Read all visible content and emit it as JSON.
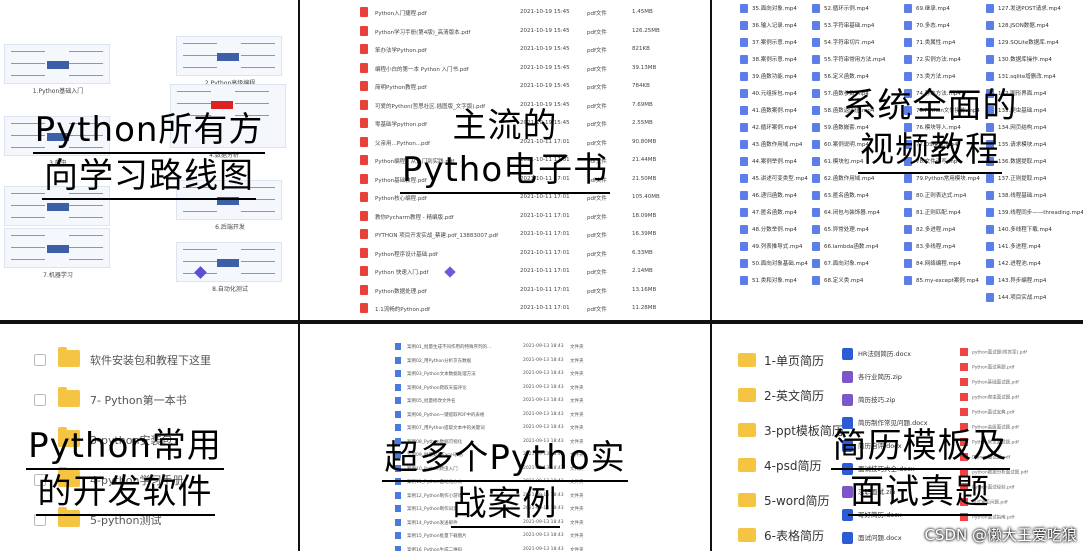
{
  "panels": {
    "roadmap": {
      "title_line1": "Python所有方",
      "title_line2": "向学习路线图",
      "maps": [
        {
          "caption": "1.Python基础入门"
        },
        {
          "caption": "2.Python高级编程"
        },
        {
          "caption": "3.爬虫"
        },
        {
          "caption": "4.数据分析"
        },
        {
          "caption": "5.前端开发"
        },
        {
          "caption": "6.后端开发"
        },
        {
          "caption": "7.机器学习"
        },
        {
          "caption": "8.自动化测试"
        }
      ]
    },
    "ebooks": {
      "title_line1": "主流的",
      "title_line2": "Pytho电子书",
      "rows": [
        {
          "name": "Python入门捷程.pdf",
          "date": "2021-10-19 15:45",
          "type": "pdf文件",
          "size": "1.45MB"
        },
        {
          "name": "Python学习手册(第4版)_高清版本.pdf",
          "date": "2021-10-19 15:45",
          "type": "pdf文件",
          "size": "126.25MB"
        },
        {
          "name": "笨办法学Python.pdf",
          "date": "2021-10-19 15:45",
          "type": "pdf文件",
          "size": "821KB"
        },
        {
          "name": "编程小白的第一本 Python 入门书.pdf",
          "date": "2021-10-19 15:45",
          "type": "pdf文件",
          "size": "39.13MB"
        },
        {
          "name": "简明Python教程.pdf",
          "date": "2021-10-19 15:45",
          "type": "pdf文件",
          "size": "784KB"
        },
        {
          "name": "可爱的Python(哲思社区.插图版_文字版).pdf",
          "date": "2021-10-19 15:45",
          "type": "pdf文件",
          "size": "7.69MB"
        },
        {
          "name": "零基础学python.pdf",
          "date": "2021-10-19 15:45",
          "type": "pdf文件",
          "size": "2.55MB"
        },
        {
          "name": "父亲用...Python...pdf",
          "date": "2021-10-11 17:01",
          "type": "pdf文件",
          "size": "90.80MB"
        },
        {
          "name": "Python编程：从入门到实践.pdf",
          "date": "2021-10-11 17:01",
          "type": "pdf文件",
          "size": "21.44MB"
        },
        {
          "name": "Python基础教程.pdf",
          "date": "2021-10-11 17:01",
          "type": "pdf文件",
          "size": "21.50MB"
        },
        {
          "name": "Python核心编程.pdf",
          "date": "2021-10-11 17:01",
          "type": "pdf文件",
          "size": "105.40MB"
        },
        {
          "name": "教你Pycharm教程 - 精编版.pdf",
          "date": "2021-10-11 17:01",
          "type": "pdf文件",
          "size": "18.09MB"
        },
        {
          "name": "PYTHON 项目开发实战_蔡建.pdf_13883007.pdf",
          "date": "2021-10-11 17:01",
          "type": "pdf文件",
          "size": "16.39MB"
        },
        {
          "name": "Python程序设计基础.pdf",
          "date": "2021-10-11 17:01",
          "type": "pdf文件",
          "size": "6.33MB"
        },
        {
          "name": "Python 快速入门.pdf",
          "date": "2021-10-11 17:01",
          "type": "pdf文件",
          "size": "2.14MB"
        },
        {
          "name": "Python数据处理.pdf",
          "date": "2021-10-11 17:01",
          "type": "pdf文件",
          "size": "13.16MB"
        },
        {
          "name": "1.1流畅的Python.pdf",
          "date": "2021-10-11 17:01",
          "type": "pdf文件",
          "size": "11.28MB"
        }
      ]
    },
    "videos": {
      "title_line1": "系统全面的",
      "title_line2": "视频教程",
      "col1": [
        "35.面向对象.mp4",
        "36.输入记录.mp4",
        "37.案例示意.mp4",
        "38.案例示意.mp4",
        "39.函数功能.mp4",
        "40.元组拆包.mp4",
        "41.函数案例.mp4",
        "42.循环案例.mp4",
        "43.函数作用域.mp4",
        "44.案例举例.mp4",
        "45.讲述可变类型.mp4",
        "46.递归函数.mp4",
        "47.匿名函数.mp4",
        "48.分数举例.mp4",
        "49.列表推导式.mp4",
        "50.面向对象基础.mp4",
        "51.类和对象.mp4"
      ],
      "col2": [
        "52.循环示例.mp4",
        "53.字符串基础.mp4",
        "54.字符串切片.mp4",
        "55.字符串常用方法.mp4",
        "56.定义函数.mp4",
        "57.函数参数.mp4",
        "58.函数返回值.mp4",
        "59.函数嵌套.mp4",
        "60.案例说明.mp4",
        "61.模块包.mp4",
        "62.函数作用域.mp4",
        "63.匿名函数.mp4",
        "64.闭包与装饰器.mp4",
        "65.异常处理.mp4",
        "66.lambda函数.mp4",
        "67.面向对象.mp4",
        "68.定义类.mp4"
      ],
      "col3": [
        "69.继承.mp4",
        "70.多态.mp4",
        "71.类属性.mp4",
        "72.实例方法.mp4",
        "73.类方法.mp4",
        "74.静态方法.mp4",
        "75.Python文件操作.mp4",
        "76.模块导入.mp4",
        "77.OS模块.mp4",
        "78.文件读写.mp4",
        "79.Python常用模块.mp4",
        "80.正则表达式.mp4",
        "81.正则匹配.mp4",
        "82.多进程.mp4",
        "83.多线程.mp4",
        "84.网络编程.mp4",
        "85.my-except案例.mp4"
      ],
      "col4": [
        "127.发送POST请求.mp4",
        "128.JSON数据.mp4",
        "129.SQLite数据库.mp4",
        "130.数据库操作.mp4",
        "131.sqlite增删改.mp4",
        "132.图形界面.mp4",
        "133.爬虫基础.mp4",
        "134.网页结构.mp4",
        "135.请求模块.mp4",
        "136.数据提取.mp4",
        "137.正则提取.mp4",
        "138.线程基础.mp4",
        "139.线程同步——threading.mp4",
        "140.多线程下载.mp4",
        "141.多进程.mp4",
        "142.进程池.mp4",
        "143.异步编程.mp4",
        "144.项目实战.mp4"
      ]
    },
    "software": {
      "title_line1": "Python常用",
      "title_line2": "的开发软件",
      "folders": [
        "软件安装包和教程下这里",
        "7- Python第一本书",
        "3-python安装包",
        "4-python学习手册",
        "5-python测试"
      ]
    },
    "cases": {
      "title_line1": "超多个Pytho实",
      "title_line2": "战案例",
      "rows": [
        {
          "name": "案例01_批量生成不同作用的特殊序列的...",
          "date": "2021-09-13 18:43",
          "type": "文件夹"
        },
        {
          "name": "案例02_用Python分析京东数据",
          "date": "2021-09-13 18:43",
          "type": "文件夹"
        },
        {
          "name": "案例03_Python文本数据处理方法",
          "date": "2021-09-13 18:43",
          "type": "文件夹"
        },
        {
          "name": "案例04_Python爬取天猫评论",
          "date": "2021-09-13 18:43",
          "type": "文件夹"
        },
        {
          "name": "案例05_批量修改文件名",
          "date": "2021-09-13 18:43",
          "type": "文件夹"
        },
        {
          "name": "案例06_Python一键提取PDF中的表格",
          "date": "2021-09-13 18:43",
          "type": "文件夹"
        },
        {
          "name": "案例07_用Python提取文本中的关键词",
          "date": "2021-09-13 18:43",
          "type": "文件夹"
        },
        {
          "name": "案例08_Python数据可视化",
          "date": "2021-09-13 18:43",
          "type": "文件夹"
        },
        {
          "name": "案例09_批量处理Excel表格",
          "date": "2021-09-13 18:43",
          "type": "文件夹"
        },
        {
          "name": "案例10_Python爬虫入门",
          "date": "2021-09-13 18:43",
          "type": "文件夹"
        },
        {
          "name": "案例11_Python自动化办公",
          "date": "2021-09-13 18:43",
          "type": "文件夹"
        },
        {
          "name": "案例12_Python制作小游戏",
          "date": "2021-09-13 18:43",
          "type": "文件夹"
        },
        {
          "name": "案例13_Python制作词云",
          "date": "2021-09-13 18:43",
          "type": "文件夹"
        },
        {
          "name": "案例14_Python发送邮件",
          "date": "2021-09-13 18:43",
          "type": "文件夹"
        },
        {
          "name": "案例15_Python批量下载图片",
          "date": "2021-09-13 18:43",
          "type": "文件夹"
        },
        {
          "name": "案例16_Python生成二维码",
          "date": "2021-09-13 18:43",
          "type": "文件夹"
        }
      ]
    },
    "resume": {
      "title_line1": "简历模板及",
      "title_line2": "面试真题",
      "folders": [
        "1-单页简历",
        "2-英文简历",
        "3-ppt模板简历",
        "4-psd简历",
        "5-word简历",
        "6-表格简历"
      ],
      "docs": [
        {
          "name": "HR法则简历.docx",
          "color": "#2b5cd6"
        },
        {
          "name": "各行业简历.zip",
          "color": "#7a56c8"
        },
        {
          "name": "简历技巧.zip",
          "color": "#7a56c8"
        },
        {
          "name": "简历制作常见问题.docx",
          "color": "#2b5cd6"
        },
        {
          "name": "简历自评.docx",
          "color": "#2b5cd6"
        },
        {
          "name": "面试技巧大全.docx",
          "color": "#2b5cd6"
        },
        {
          "name": "求职面试.zip",
          "color": "#7a56c8"
        },
        {
          "name": "写好简历.docx",
          "color": "#2b5cd6"
        },
        {
          "name": "面试问题.docx",
          "color": "#2b5cd6"
        }
      ],
      "side_docs": [
        "python面试题(附答案).pdf",
        "Python面试真题.pdf",
        "Python基础面试题.pdf",
        "python爬虫面试题.pdf",
        "Python面试宝典.pdf",
        "Python高级面试题.pdf",
        "Python常见面试题.pdf",
        "Django面试题.pdf",
        "python数据分析面试题.pdf",
        "Python面试经验.pdf",
        "面试常见问题.pdf",
        "Python面试指南.pdf"
      ]
    }
  },
  "watermark": "CSDN @懒大王爱吃狼"
}
